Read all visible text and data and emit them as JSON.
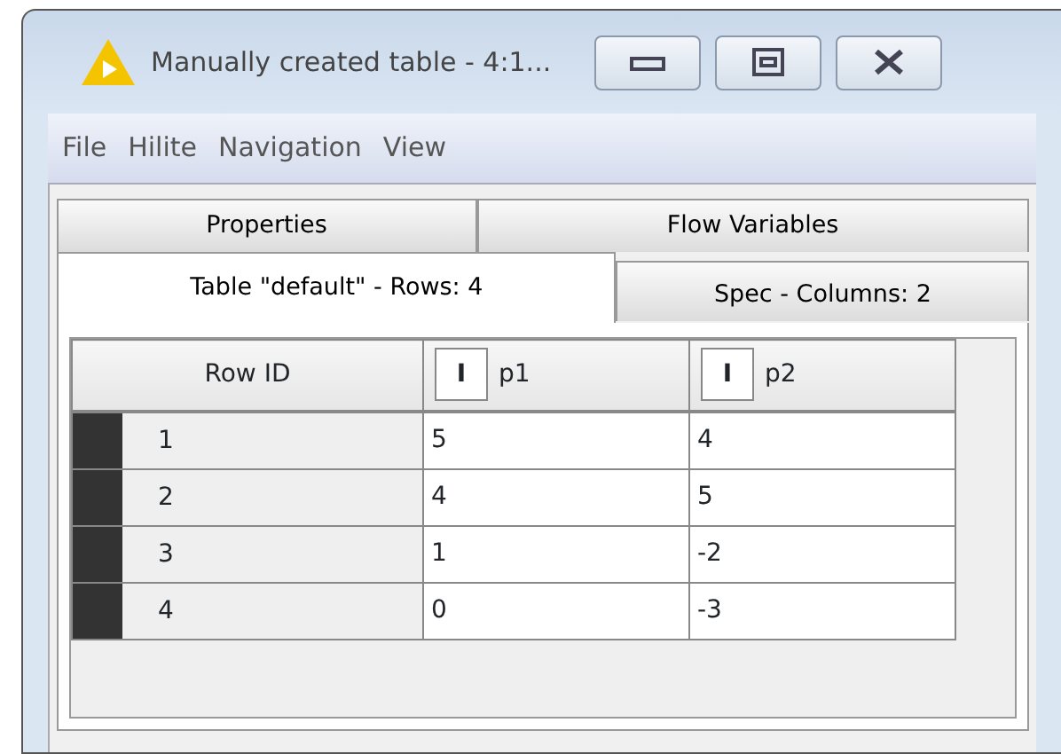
{
  "window": {
    "title": "Manually created table - 4:1...",
    "controls": [
      {
        "kind": "minimize"
      },
      {
        "kind": "maximize"
      },
      {
        "kind": "close"
      }
    ]
  },
  "menu": [
    "File",
    "Hilite",
    "Navigation",
    "View"
  ],
  "tab_rows": [
    [
      {
        "label": "Properties",
        "selected": false
      },
      {
        "label": "Flow Variables",
        "selected": false
      }
    ],
    [
      {
        "label": "Table \"default\" - Rows: 4",
        "selected": true
      },
      {
        "label": "Spec - Columns: 2",
        "selected": false
      }
    ]
  ],
  "table": {
    "columns": [
      {
        "label": "Row ID"
      },
      {
        "label": "p1",
        "type_icon": "I"
      },
      {
        "label": "p2",
        "type_icon": "I"
      }
    ],
    "rows": [
      [
        "1",
        "5",
        "4"
      ],
      [
        "2",
        "4",
        "5"
      ],
      [
        "3",
        "1",
        "-2"
      ],
      [
        "4",
        "0",
        "-3"
      ]
    ]
  }
}
